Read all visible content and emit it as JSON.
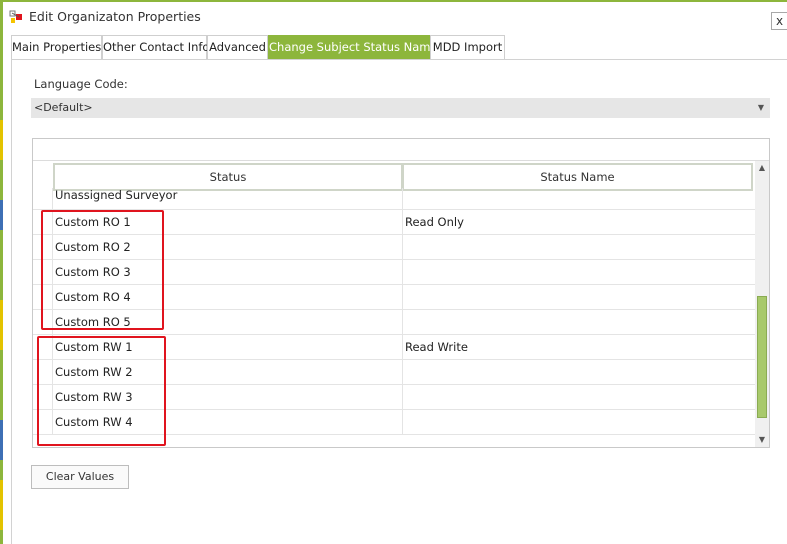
{
  "window": {
    "title": "Edit Organizaton Properties",
    "close_glyph": "x",
    "icon": "app-properties-icon"
  },
  "tabs": [
    {
      "label": "Main Properties",
      "active": false
    },
    {
      "label": "Other Contact Info",
      "active": false
    },
    {
      "label": "Advanced",
      "active": false
    },
    {
      "label": "Change Subject Status Names",
      "active": true
    },
    {
      "label": "MDD Import",
      "active": false
    }
  ],
  "language": {
    "label": "Language Code:",
    "selected": "<Default>",
    "dropdown_icon": "chevron-down-icon"
  },
  "grid": {
    "columns": [
      "Status",
      "Status Name"
    ],
    "rows": [
      {
        "status": "Unassigned Surveyor",
        "name": ""
      },
      {
        "status": "Custom RO 1",
        "name": "Read Only"
      },
      {
        "status": "Custom RO 2",
        "name": ""
      },
      {
        "status": "Custom RO 3",
        "name": ""
      },
      {
        "status": "Custom RO 4",
        "name": ""
      },
      {
        "status": "Custom RO 5",
        "name": ""
      },
      {
        "status": "Custom RW 1",
        "name": "Read Write"
      },
      {
        "status": "Custom RW 2",
        "name": ""
      },
      {
        "status": "Custom RW 3",
        "name": ""
      },
      {
        "status": "Custom RW 4",
        "name": ""
      }
    ],
    "scroll_up_icon": "arrow-up-icon",
    "scroll_down_icon": "arrow-down-icon"
  },
  "buttons": {
    "clear_values": "Clear Values"
  },
  "colors": {
    "accent": "#8db63c",
    "highlight": "#e0141e",
    "scroll_thumb": "#a8c96b"
  }
}
